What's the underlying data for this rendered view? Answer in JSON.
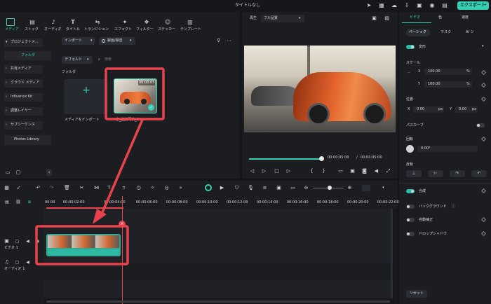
{
  "title": "タイトルなし",
  "export_label": "エクスポート",
  "toolbar": {
    "items": [
      "メディア",
      "ストック",
      "オーディオ",
      "タイトル",
      "トランジション",
      "エフェクト",
      "フィルター",
      "ステッカー",
      "テンプレート"
    ]
  },
  "sidebar": {
    "items": [
      "プロジェクトメ...",
      "フォルダ",
      "共有メディア",
      "クラウド メディア",
      "Influence Kit",
      "調整レイヤー",
      "サブシーケンス",
      "Photos Library"
    ]
  },
  "media": {
    "import_label": "インポート",
    "filter_label": "録画/録音",
    "sort_label": "デフォルト",
    "search_placeholder": "検索",
    "folder_label": "フォルダ",
    "import_tile_label": "メディアをインポート",
    "clip_name": "車_連続写真_0",
    "clip_duration": "00:00:05"
  },
  "preview": {
    "play_label": "再生",
    "quality": "フル品質",
    "current_time": "00:00:05:00",
    "separator": "/",
    "total_time": "00:00:05:00"
  },
  "timeline": {
    "ruler": [
      "00:00",
      "00:00:02:00",
      "00:00:04:00",
      "00:00:06:00",
      "00:00:08:00",
      "00:00:10:00",
      "00:00:12:00",
      "00:00:14:00",
      "00:00:16:00",
      "00:00:18:00",
      "00:00:20:00",
      "00:00:22:00"
    ],
    "video_track": "ビデオ 1",
    "audio_track": "オーディオ 1",
    "playhead_marker": "×"
  },
  "props": {
    "tabs": [
      "ビデオ",
      "色",
      "速度"
    ],
    "subtabs": [
      "ベーシック",
      "マスク",
      "AI ツ"
    ],
    "transform": "変形",
    "scale": "スケール",
    "x_label": "X",
    "y_label": "Y",
    "scale_x": "100.00",
    "scale_y": "100.00",
    "percent": "%",
    "position": "位置",
    "pos_x": "0.00",
    "pos_y": "0.00",
    "px": "px",
    "path_curve": "パスカーブ",
    "rotation": "回転",
    "rotation_value": "0.00°",
    "flip": "反転",
    "composite": "合成",
    "background": "バックグラウンド",
    "auto_enhance": "自動補正",
    "drop_shadow": "ドロップシャドウ",
    "reset": "リセット"
  },
  "colors": {
    "accent": "#2fb9a3",
    "highlight": "#e8434c",
    "export": "#35d0b4"
  }
}
